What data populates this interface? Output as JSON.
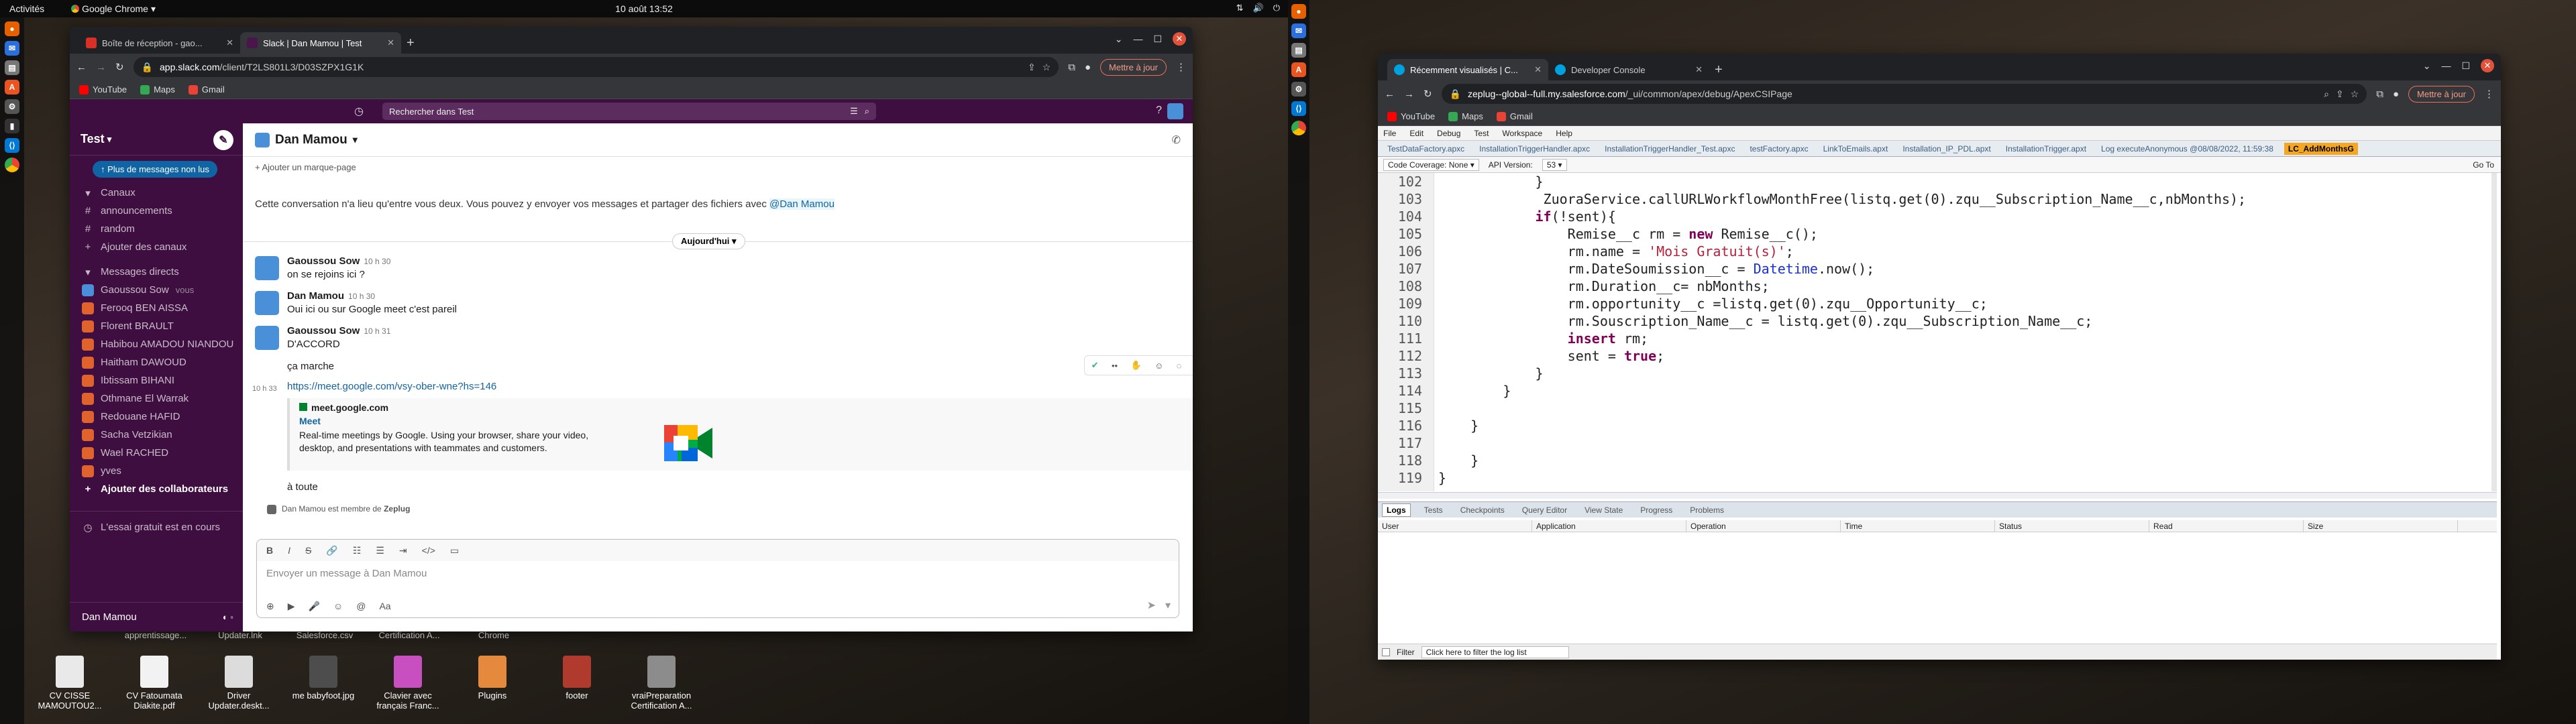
{
  "topbar": {
    "activities": "Activités",
    "app": "Google Chrome",
    "clock": "10 août  13:52"
  },
  "desktop_left": [
    {
      "label": "CV CISSE MAMOUTOU2...",
      "color": "#e9e9e9"
    },
    {
      "label": "CV Fatoumata Diakite.pdf",
      "color": "#f2f2f2"
    },
    {
      "label": "Driver Updater.deskt...",
      "color": "#dcdcdc"
    },
    {
      "label": "me babyfoot.jpg",
      "color": "#4d4d4d"
    },
    {
      "label": "Clavier avec français Franc...",
      "color": "#c74fc0"
    },
    {
      "label": "Plugins",
      "color": "#e58a3c"
    },
    {
      "label": "footer",
      "color": "#b03a2e"
    },
    {
      "label": "vraiPreparation Certification A...",
      "color": "#8c8c8c"
    }
  ],
  "desktop_mid": [
    {
      "label": "apprentissage..."
    },
    {
      "label": "Updater.lnk"
    },
    {
      "label": "Salesforce.csv"
    },
    {
      "label": "Certification A..."
    },
    {
      "label": "Chrome"
    }
  ],
  "slack_window": {
    "tabs": [
      {
        "label": "Boîte de réception - gao...",
        "fav_color": "#d93025"
      },
      {
        "label": "Slack | Dan Mamou | Test",
        "fav_color": "#4a154b"
      }
    ],
    "url_host": "app.slack.com",
    "url_path": "/client/T2LS801L3/D03SZPX1G1K",
    "update_button": "Mettre à jour",
    "bookmarks": [
      {
        "label": "YouTube",
        "color": "#ff0000"
      },
      {
        "label": "Maps",
        "color": "#34a853"
      },
      {
        "label": "Gmail",
        "color": "#ea4335"
      }
    ]
  },
  "slack": {
    "search_placeholder": "Rechercher dans Test",
    "workspace": "Test",
    "unread_pill": "Plus de messages non lus",
    "sections": {
      "channels": "Canaux",
      "dms": "Messages directs"
    },
    "channels": [
      "announcements",
      "random",
      "Ajouter des canaux"
    ],
    "dms": [
      {
        "name": "Gaoussou Sow",
        "color": "#4a90d9",
        "you": "vous"
      },
      {
        "name": "Ferooq BEN AISSA",
        "color": "#e0632e"
      },
      {
        "name": "Florent BRAULT",
        "color": "#e0632e"
      },
      {
        "name": "Habibou AMADOU NIANDOU",
        "color": "#e0632e"
      },
      {
        "name": "Haitham DAWOUD",
        "color": "#e0632e"
      },
      {
        "name": "Ibtissam BIHANI",
        "color": "#e0632e"
      },
      {
        "name": "Othmane El Warrak",
        "color": "#e0632e"
      },
      {
        "name": "Redouane HAFID",
        "color": "#e0632e"
      },
      {
        "name": "Sacha Vetzikian",
        "color": "#e0632e"
      },
      {
        "name": "Wael RACHED",
        "color": "#e0632e"
      },
      {
        "name": "yves",
        "color": "#e0632e"
      }
    ],
    "add_collab": "Ajouter des collaborateurs",
    "trial": "L'essai gratuit est en cours",
    "current_user": "Dan Mamou",
    "channel_title": "Dan Mamou",
    "bookmark_add": "Ajouter un marque-page",
    "intro": "Cette conversation n'a lieu qu'entre vous deux. Vous pouvez y envoyer vos messages et partager des fichiers avec",
    "intro_mention": "@Dan Mamou",
    "date_divider": "Aujourd'hui",
    "messages": [
      {
        "name": "Gaoussou Sow",
        "time": "10 h 30",
        "text": "on se rejoins ici ?",
        "color": "#4a90d9"
      },
      {
        "name": "Dan Mamou",
        "time": "10 h 30",
        "text": "Oui ici ou sur Google meet c'est pareil",
        "color": "#4a90d9"
      },
      {
        "name": "Gaoussou Sow",
        "time": "10 h 31",
        "text": "D'ACCORD",
        "color": "#4a90d9"
      }
    ],
    "cont_1": "ça marche",
    "cont_time": "10 h 33",
    "link": "https://meet.google.com/vsy-ober-wne?hs=146",
    "preview": {
      "site": "meet.google.com",
      "title": "Meet",
      "desc": "Real-time meetings by Google. Using your browser, share your video, desktop, and presentations with teammates and customers."
    },
    "cont_2": "à toute",
    "join_notice": "Dan Mamou est membre de",
    "join_org": "Zeplug",
    "compose_placeholder": "Envoyer un message à Dan Mamou"
  },
  "sf_window": {
    "tabs": [
      {
        "label": "Récemment visualisés | C...",
        "fav_color": "#00a1e0"
      },
      {
        "label": "Developer Console",
        "fav_color": "#00a1e0"
      }
    ],
    "url_host": "zeplug--global--full.my.salesforce.com",
    "url_path": "/_ui/common/apex/debug/ApexCSIPage",
    "update_button": "Mettre à jour",
    "bookmarks": [
      {
        "label": "YouTube",
        "color": "#ff0000"
      },
      {
        "label": "Maps",
        "color": "#34a853"
      },
      {
        "label": "Gmail",
        "color": "#ea4335"
      }
    ]
  },
  "devconsole": {
    "menu": [
      "File",
      "Edit",
      "Debug",
      "Test",
      "Workspace",
      "Help"
    ],
    "file_tabs": [
      "TestDataFactory.apxc",
      "InstallationTriggerHandler.apxc",
      "InstallationTriggerHandler_Test.apxc",
      "testFactory.apxc",
      "LinkToEmails.apxt",
      "Installation_IP_PDL.apxt",
      "InstallationTrigger.apxt",
      "Log executeAnonymous @08/08/2022, 11:59:38",
      "LC_AddMonthsG"
    ],
    "coverage": "Code Coverage: None",
    "api_label": "API Version:",
    "api_value": "53",
    "goto": "Go To",
    "code_lines": [
      {
        "n": "102",
        "t": "            }"
      },
      {
        "n": "103",
        "t": "             ZuoraService.callURLWorkflowMonthFree(listq.get(0).zqu__Subscription_Name__c,nbMonths);"
      },
      {
        "n": "104",
        "t": "            if(!sent){"
      },
      {
        "n": "105",
        "t": "                Remise__c rm = new Remise__c();"
      },
      {
        "n": "106",
        "t": "                rm.name = 'Mois Gratuit(s)';"
      },
      {
        "n": "107",
        "t": "                rm.DateSoumission__c = Datetime.now();"
      },
      {
        "n": "108",
        "t": "                rm.Duration__c= nbMonths;"
      },
      {
        "n": "109",
        "t": "                rm.opportunity__c =listq.get(0).zqu__Opportunity__c;"
      },
      {
        "n": "110",
        "t": "                rm.Souscription_Name__c = listq.get(0).zqu__Subscription_Name__c;"
      },
      {
        "n": "111",
        "t": "                insert rm;"
      },
      {
        "n": "112",
        "t": "                sent = true;"
      },
      {
        "n": "113",
        "t": "            }"
      },
      {
        "n": "114",
        "t": "        }"
      },
      {
        "n": "115",
        "t": ""
      },
      {
        "n": "116",
        "t": "    }"
      },
      {
        "n": "117",
        "t": ""
      },
      {
        "n": "118",
        "t": "    }"
      },
      {
        "n": "119",
        "t": "}"
      }
    ],
    "bottom_tabs": [
      "Logs",
      "Tests",
      "Checkpoints",
      "Query Editor",
      "View State",
      "Progress",
      "Problems"
    ],
    "log_columns": [
      "User",
      "Application",
      "Operation",
      "Time",
      "Status",
      "Read",
      "Size"
    ],
    "filter_label": "Filter",
    "filter_placeholder": "Click here to filter the log list"
  }
}
